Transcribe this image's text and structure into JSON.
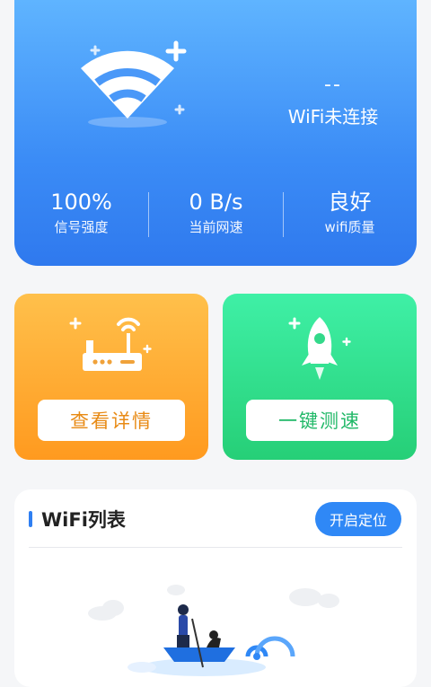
{
  "hero": {
    "status_value": "--",
    "status_text": "WiFi未连接",
    "stats": [
      {
        "value": "100%",
        "label": "信号强度"
      },
      {
        "value": "0 B/s",
        "label": "当前网速"
      },
      {
        "value": "良好",
        "label": "wifi质量"
      }
    ]
  },
  "cards": {
    "details_label": "查看详情",
    "speedtest_label": "一键测速"
  },
  "wifi_list": {
    "title": "WiFi列表",
    "locate_label": "开启定位"
  },
  "colors": {
    "primary": "#2f88f6",
    "orange": "#ff9a1f",
    "green": "#26cf77"
  }
}
